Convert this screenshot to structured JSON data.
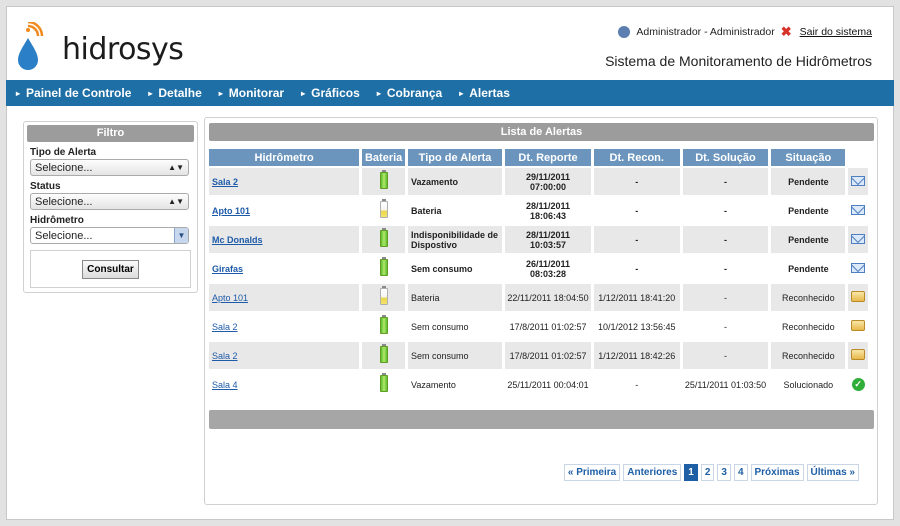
{
  "brand": {
    "name": "hidrosys"
  },
  "user": {
    "name": "Administrador - Administrador",
    "logout": "Sair do sistema"
  },
  "system_title": "Sistema de Monitoramento de Hidrômetros",
  "nav": [
    "Painel de Controle",
    "Detalhe",
    "Monitorar",
    "Gráficos",
    "Cobrança",
    "Alertas"
  ],
  "filter": {
    "title": "Filtro",
    "tipo_label": "Tipo de Alerta",
    "tipo_value": "Selecione...",
    "status_label": "Status",
    "status_value": "Selecione...",
    "hidrometro_label": "Hidrômetro",
    "hidrometro_value": "Selecione...",
    "button": "Consultar"
  },
  "list": {
    "title": "Lista de Alertas",
    "columns": [
      "Hidrômetro",
      "Bateria",
      "Tipo de Alerta",
      "Dt. Reporte",
      "Dt. Recon.",
      "Dt. Solução",
      "Situação"
    ],
    "rows": [
      {
        "hidrometro": "Sala 2",
        "battery": "full",
        "tipo": "Vazamento",
        "reporte": "29/11/2011 07:00:00",
        "recon": "-",
        "solucao": "-",
        "situacao": "Pendente",
        "icon": "mail-icon"
      },
      {
        "hidrometro": "Apto 101",
        "battery": "low",
        "tipo": "Bateria",
        "reporte": "28/11/2011 18:06:43",
        "recon": "-",
        "solucao": "-",
        "situacao": "Pendente",
        "icon": "mail-icon"
      },
      {
        "hidrometro": "Mc Donalds",
        "battery": "full",
        "tipo": "Indisponibilidade de Dispostivo",
        "reporte": "28/11/2011 10:03:57",
        "recon": "-",
        "solucao": "-",
        "situacao": "Pendente",
        "icon": "mail-icon"
      },
      {
        "hidrometro": "Girafas",
        "battery": "full",
        "tipo": "Sem consumo",
        "reporte": "26/11/2011 08:03:28",
        "recon": "-",
        "solucao": "-",
        "situacao": "Pendente",
        "icon": "mail-icon"
      },
      {
        "hidrometro": "Apto 101",
        "battery": "low",
        "tipo": "Bateria",
        "reporte": "22/11/2011 18:04:50",
        "recon": "1/12/2011 18:41:20",
        "solucao": "-",
        "situacao": "Reconhecido",
        "icon": "open-mail-icon"
      },
      {
        "hidrometro": "Sala 2",
        "battery": "full",
        "tipo": "Sem consumo",
        "reporte": "17/8/2011 01:02:57",
        "recon": "10/1/2012 13:56:45",
        "solucao": "-",
        "situacao": "Reconhecido",
        "icon": "open-mail-icon"
      },
      {
        "hidrometro": "Sala 2",
        "battery": "full",
        "tipo": "Sem consumo",
        "reporte": "17/8/2011 01:02:57",
        "recon": "1/12/2011 18:42:26",
        "solucao": "-",
        "situacao": "Reconhecido",
        "icon": "open-mail-icon"
      },
      {
        "hidrometro": "Sala 4",
        "battery": "full",
        "tipo": "Vazamento",
        "reporte": "25/11/2011 00:04:01",
        "recon": "-",
        "solucao": "25/11/2011 01:03:50",
        "situacao": "Solucionado",
        "icon": "check-icon"
      }
    ]
  },
  "pager": {
    "first": "« Primeira",
    "prev": "Anteriores",
    "pages": [
      "1",
      "2",
      "3",
      "4"
    ],
    "active": "1",
    "next": "Próximas",
    "last": "Últimas »"
  }
}
